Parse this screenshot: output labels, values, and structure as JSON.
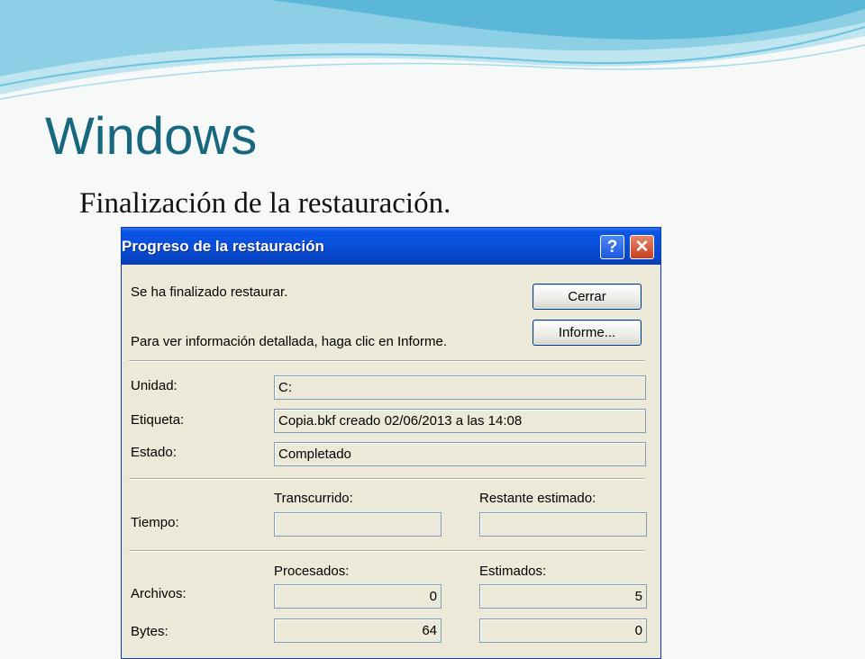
{
  "slide": {
    "title": "Windows",
    "subtitle": "Finalización de la restauración."
  },
  "dialog": {
    "title": "Progreso de la restauración",
    "help_button": "?",
    "close_button": "✕",
    "message": "Se ha finalizado restaurar.",
    "info_text": "Para ver información detallada, haga clic en Informe.",
    "close_label": "Cerrar",
    "report_label": "Informe...",
    "drive_label": "Unidad:",
    "drive_value": "C:",
    "tag_label": "Etiqueta:",
    "tag_value": "Copia.bkf creado 02/06/2013 a las 14:08",
    "status_label": "Estado:",
    "status_value": "Completado",
    "time_label": "Tiempo:",
    "elapsed_header": "Transcurrido:",
    "remaining_header": "Restante estimado:",
    "elapsed_value": "",
    "remaining_value": "",
    "processed_header": "Procesados:",
    "estimated_header": "Estimados:",
    "files_label": "Archivos:",
    "files_processed": "0",
    "files_estimated": "5",
    "bytes_label": "Bytes:",
    "bytes_processed": "64",
    "bytes_estimated": "0"
  },
  "colors": {
    "title_text": "#17677e",
    "xp_blue": "#0a4ed8",
    "dialog_face": "#ece9d8"
  }
}
